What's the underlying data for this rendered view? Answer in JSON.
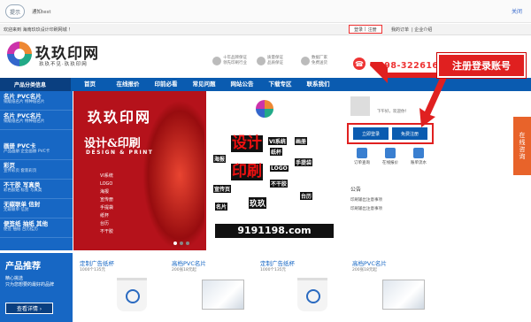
{
  "notice": {
    "icon_label": "提示",
    "text": "通知test",
    "close_label": "关闭"
  },
  "topbar": {
    "welcome": "欢迎来到 海南玖玖设计印刷网城 ！",
    "login": "登录",
    "register": "注册",
    "links": [
      "我的订单",
      "企业介绍"
    ]
  },
  "header": {
    "logo_title": "玖玖印网",
    "logo_sub": "玖玖不见·玖玖印网",
    "badges": [
      {
        "icon": "trophy-icon",
        "line1": "十年品牌保证",
        "line2": "领先印刷行业"
      },
      {
        "icon": "shield-icon",
        "line1": "质量保证",
        "line2": "品质保证"
      },
      {
        "icon": "truck-icon",
        "line1": "数据厂家",
        "line2": "免费送货"
      }
    ],
    "phone": "0898-32261631"
  },
  "callout": "注册登录账号",
  "nav": {
    "category": "产品分类信息",
    "items": [
      "首页",
      "在线报价",
      "印前必看",
      "常见问题",
      "网站公告",
      "下载专区",
      "联系我们"
    ]
  },
  "sidebar": [
    {
      "title": "名片 PVC名片",
      "sub": "铜版纸名片 特种纸名片"
    },
    {
      "title": "名片 PVC名片",
      "sub": "铜版纸名片 特种纸名片"
    },
    {
      "title": "画册 PVC卡",
      "sub": "产品画册 企业画册 PVC卡"
    },
    {
      "title": "彩页",
      "sub": "宣传彩页 套装彩页"
    },
    {
      "title": "不干胶 写真类",
      "sub": "彩色胶贴 标签 写真类"
    },
    {
      "title": "无碳联单 信封",
      "sub": "无碳联单 信封"
    },
    {
      "title": "便签纸 抽纸 其他",
      "sub": "便签 抽纸 台历挂历"
    }
  ],
  "banner": {
    "title": "玖玖印网",
    "subtitle": "设计&印刷",
    "english": "DESIGN & PRINT",
    "list": [
      "VI系统",
      "LOGO",
      "海报",
      "宣传册",
      "手提袋",
      "纸杯",
      "台历",
      "不干胶"
    ],
    "cloud_words": [
      "VI系统",
      "画册",
      "海报",
      "纸杯",
      "手提袋",
      "LOGO",
      "宣传页",
      "不干胶",
      "台历",
      "名片"
    ],
    "cloud_big": [
      "设计",
      "印刷"
    ],
    "cloud_name": "玖玖",
    "url": "9191198.com"
  },
  "rpanel": {
    "greet": "下午好，欢迎你！",
    "login_btn": "立即登录",
    "register_btn": "免费注册",
    "quick": [
      "订单查询",
      "在线报价",
      "账单流水"
    ],
    "notice_title": "公告",
    "notices": [
      "印刷输出注意事项",
      "印刷输出注意事项"
    ]
  },
  "float_tab": "在线咨询",
  "promo": {
    "title": "产品推荐",
    "line1": "精心挑选",
    "line2": "只为您想要的最好的品牌",
    "button": "查看详情 ›"
  },
  "products": [
    {
      "name": "定制广告纸杯",
      "price": "1000个135元",
      "kind": "cup"
    },
    {
      "name": "高档PVC名片",
      "price": "200张18元起",
      "kind": "card"
    },
    {
      "name": "定制广告纸杯",
      "price": "1000个135元",
      "kind": "cup"
    },
    {
      "name": "高档PVC名片",
      "price": "200张18元起",
      "kind": "card"
    }
  ]
}
